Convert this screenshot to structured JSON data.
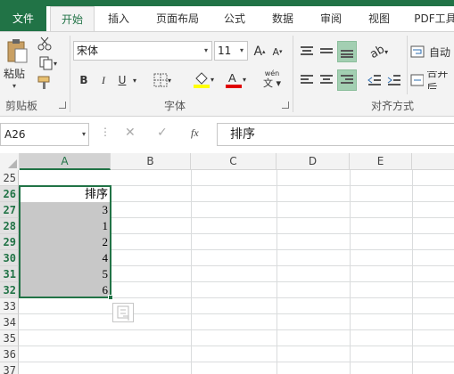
{
  "tabs": [
    "文件",
    "开始",
    "插入",
    "页面布局",
    "公式",
    "数据",
    "审阅",
    "视图",
    "PDF工具"
  ],
  "clipboard": {
    "paste_label": "粘贴",
    "group_label": "剪贴板"
  },
  "font": {
    "name": "宋体",
    "size": "11",
    "bold": "B",
    "italic": "I",
    "underline": "U",
    "phonetic": "wén",
    "group_label": "字体",
    "grow": "A",
    "shrink": "A"
  },
  "alignment": {
    "group_label": "对齐方式",
    "wrap_label": "自动",
    "merge_label": "合并后"
  },
  "formula_bar": {
    "name_box": "A26",
    "fx": "fx",
    "value": "排序"
  },
  "columns": [
    "A",
    "B",
    "C",
    "D",
    "E"
  ],
  "rows": [
    "25",
    "26",
    "27",
    "28",
    "29",
    "30",
    "31",
    "32",
    "33",
    "34",
    "35",
    "36",
    "37"
  ],
  "cells_A": [
    "",
    "排序",
    "3",
    "1",
    "2",
    "4",
    "5",
    "6"
  ],
  "colors": {
    "accent": "#217346",
    "selection_fill": "#c8c8c8"
  }
}
